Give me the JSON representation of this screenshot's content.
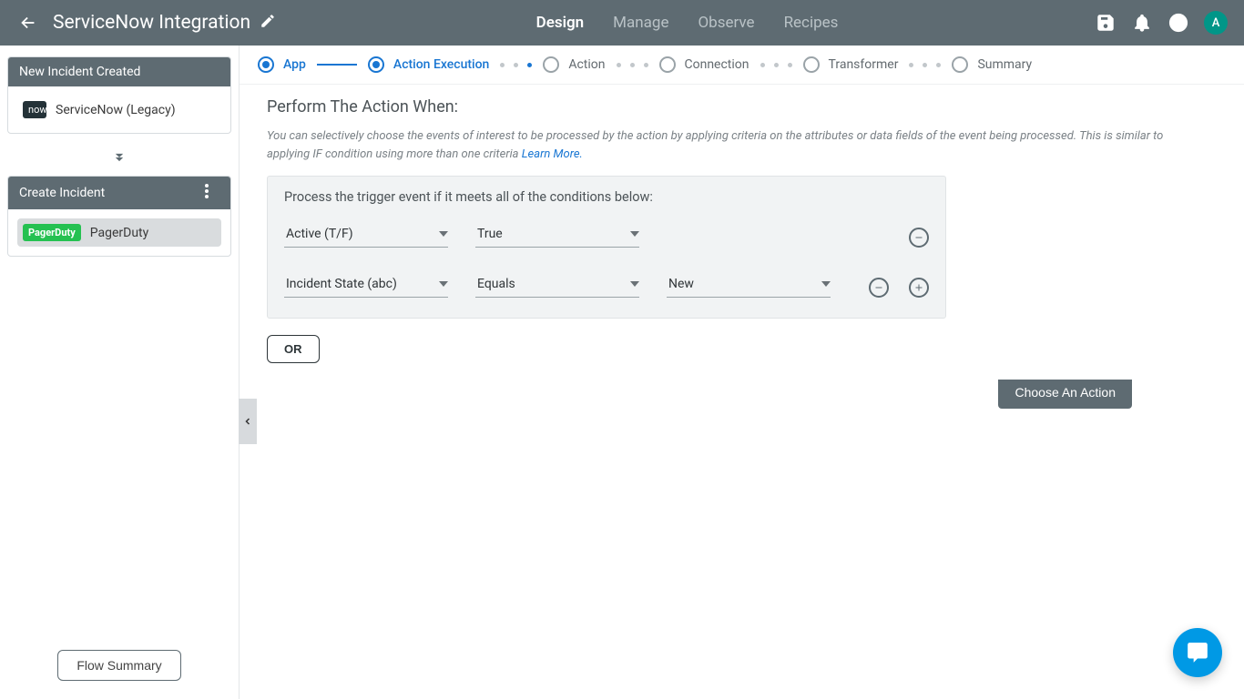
{
  "header": {
    "title": "ServiceNow Integration",
    "tabs": [
      "Design",
      "Manage",
      "Observe",
      "Recipes"
    ],
    "active_tab": 0,
    "avatar_letter": "A"
  },
  "sidebar": {
    "trigger_card": {
      "title": "New Incident Created",
      "app_chip": "now",
      "app_name": "ServiceNow (Legacy)"
    },
    "action_card": {
      "title": "Create Incident",
      "app_chip": "PagerDuty",
      "app_name": "PagerDuty"
    },
    "flow_summary": "Flow Summary"
  },
  "stepper": {
    "steps": [
      "App",
      "Action Execution",
      "Action",
      "Connection",
      "Transformer",
      "Summary"
    ]
  },
  "content": {
    "section_title": "Perform The Action When:",
    "description": "You can selectively choose the events of interest to be processed by the action by applying criteria on the attributes or data fields of the event being processed. This is similar to applying IF condition using more than one criteria  ",
    "learn_more": "Learn More.",
    "cond_block_title": "Process the trigger event if it meets all of the conditions below:",
    "conditions": [
      {
        "field": "Active (T/F)",
        "operator": "True",
        "value": ""
      },
      {
        "field": "Incident State (abc)",
        "operator": "Equals",
        "value": "New"
      }
    ],
    "or_button": "OR",
    "choose_action": "Choose An Action"
  }
}
